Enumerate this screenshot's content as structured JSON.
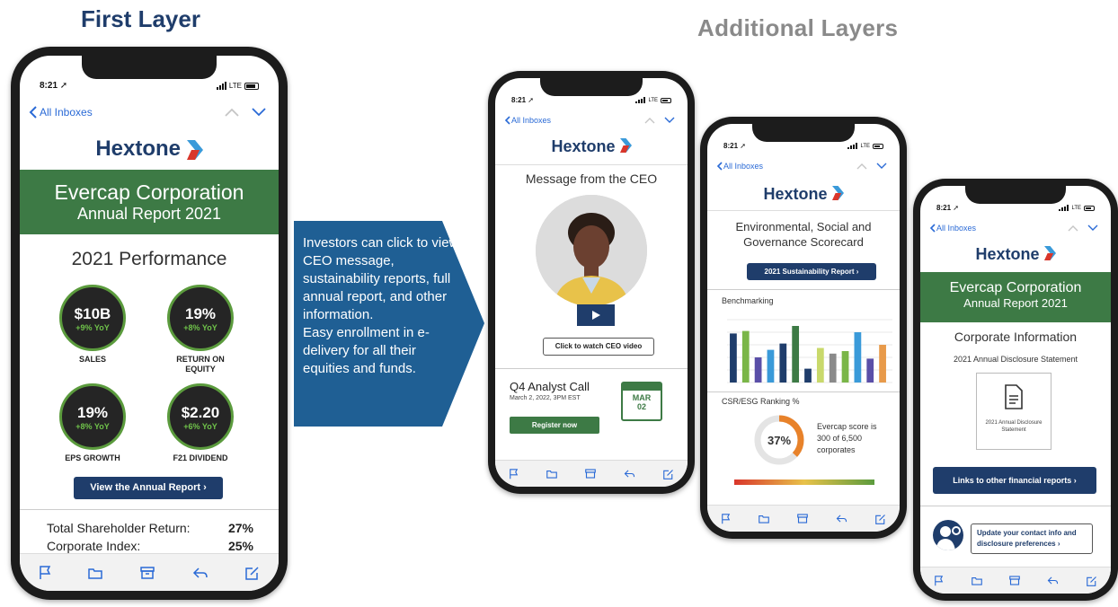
{
  "headings": {
    "first": "First Layer",
    "additional": "Additional  Layers"
  },
  "callout": {
    "text": "Investors can click to view CEO message, sustainability reports, full annual  report, and other information.\nEasy enrollment in e-delivery for all their equities and funds.",
    "color": "#1f5f94"
  },
  "colors": {
    "navy": "#1f3d6b",
    "green": "#3d7a45",
    "ios_blue": "#2a6ad6",
    "accent_blue": "#3a9ad9"
  },
  "common": {
    "time": "8:21",
    "network": "LTE",
    "back_label": "All Inboxes",
    "brand": "Hextone",
    "tab_icons": [
      "flag-icon",
      "folder-icon",
      "archive-icon",
      "reply-icon",
      "compose-icon"
    ]
  },
  "phone1": {
    "company": "Evercap Corporation",
    "report": "Annual Report 2021",
    "performance_title": "2021 Performance",
    "metrics": [
      {
        "value": "$10B",
        "delta": "+9% YoY",
        "label": "SALES"
      },
      {
        "value": "19%",
        "delta": "+8% YoY",
        "label": "RETURN ON EQUITY"
      },
      {
        "value": "19%",
        "delta": "+8% YoY",
        "label": "EPS GROWTH"
      },
      {
        "value": "$2.20",
        "delta": "+6% YoY",
        "label": "F21 DIVIDEND"
      }
    ],
    "cta": "View the Annual Report",
    "stats": [
      {
        "label": "Total Shareholder Return:",
        "value": "27%"
      },
      {
        "label": "Corporate Index:",
        "value": "25%"
      }
    ]
  },
  "phone2": {
    "title": "Message from the CEO",
    "video_button": "Click to watch CEO video",
    "event_title": "Q4 Analyst Call",
    "event_time": "March 2, 2022, 3PM EST",
    "register": "Register now",
    "calendar_month": "MAR",
    "calendar_day": "02"
  },
  "phone3": {
    "title": "Environmental, Social and Governance Scorecard",
    "button": "2021 Sustainability  Report",
    "benchmark_title": "Benchmarking",
    "ranking_title": "CSR/ESG Ranking %",
    "donut_value": "37%",
    "donut_fraction": 0.37,
    "score_text": "Evercap score is 300  of 6,500 corporates",
    "bar_values": [
      0.78,
      0.82,
      0.4,
      0.52,
      0.62,
      0.9,
      0.22,
      0.55,
      0.46,
      0.5,
      0.8,
      0.38,
      0.6
    ],
    "bar_colors": [
      "#1f3d6b",
      "#7ab648",
      "#5a4fa8",
      "#3a9ad9",
      "#1f3d6b",
      "#3d7a45",
      "#1f3d6b",
      "#c9d96b",
      "#8a8a8a",
      "#7ab648",
      "#3a9ad9",
      "#5a4fa8",
      "#e89a4a"
    ]
  },
  "phone4": {
    "company": "Evercap Corporation",
    "report": "Annual Report 2021",
    "info_title": "Corporate Information",
    "disclosure_title": "2021 Annual Disclosure Statement",
    "doc_caption": "2021 Annual Disclosure Statement",
    "links_button": "Links to other financial reports",
    "update_text": "Update your contact info and disclosure preferences"
  }
}
